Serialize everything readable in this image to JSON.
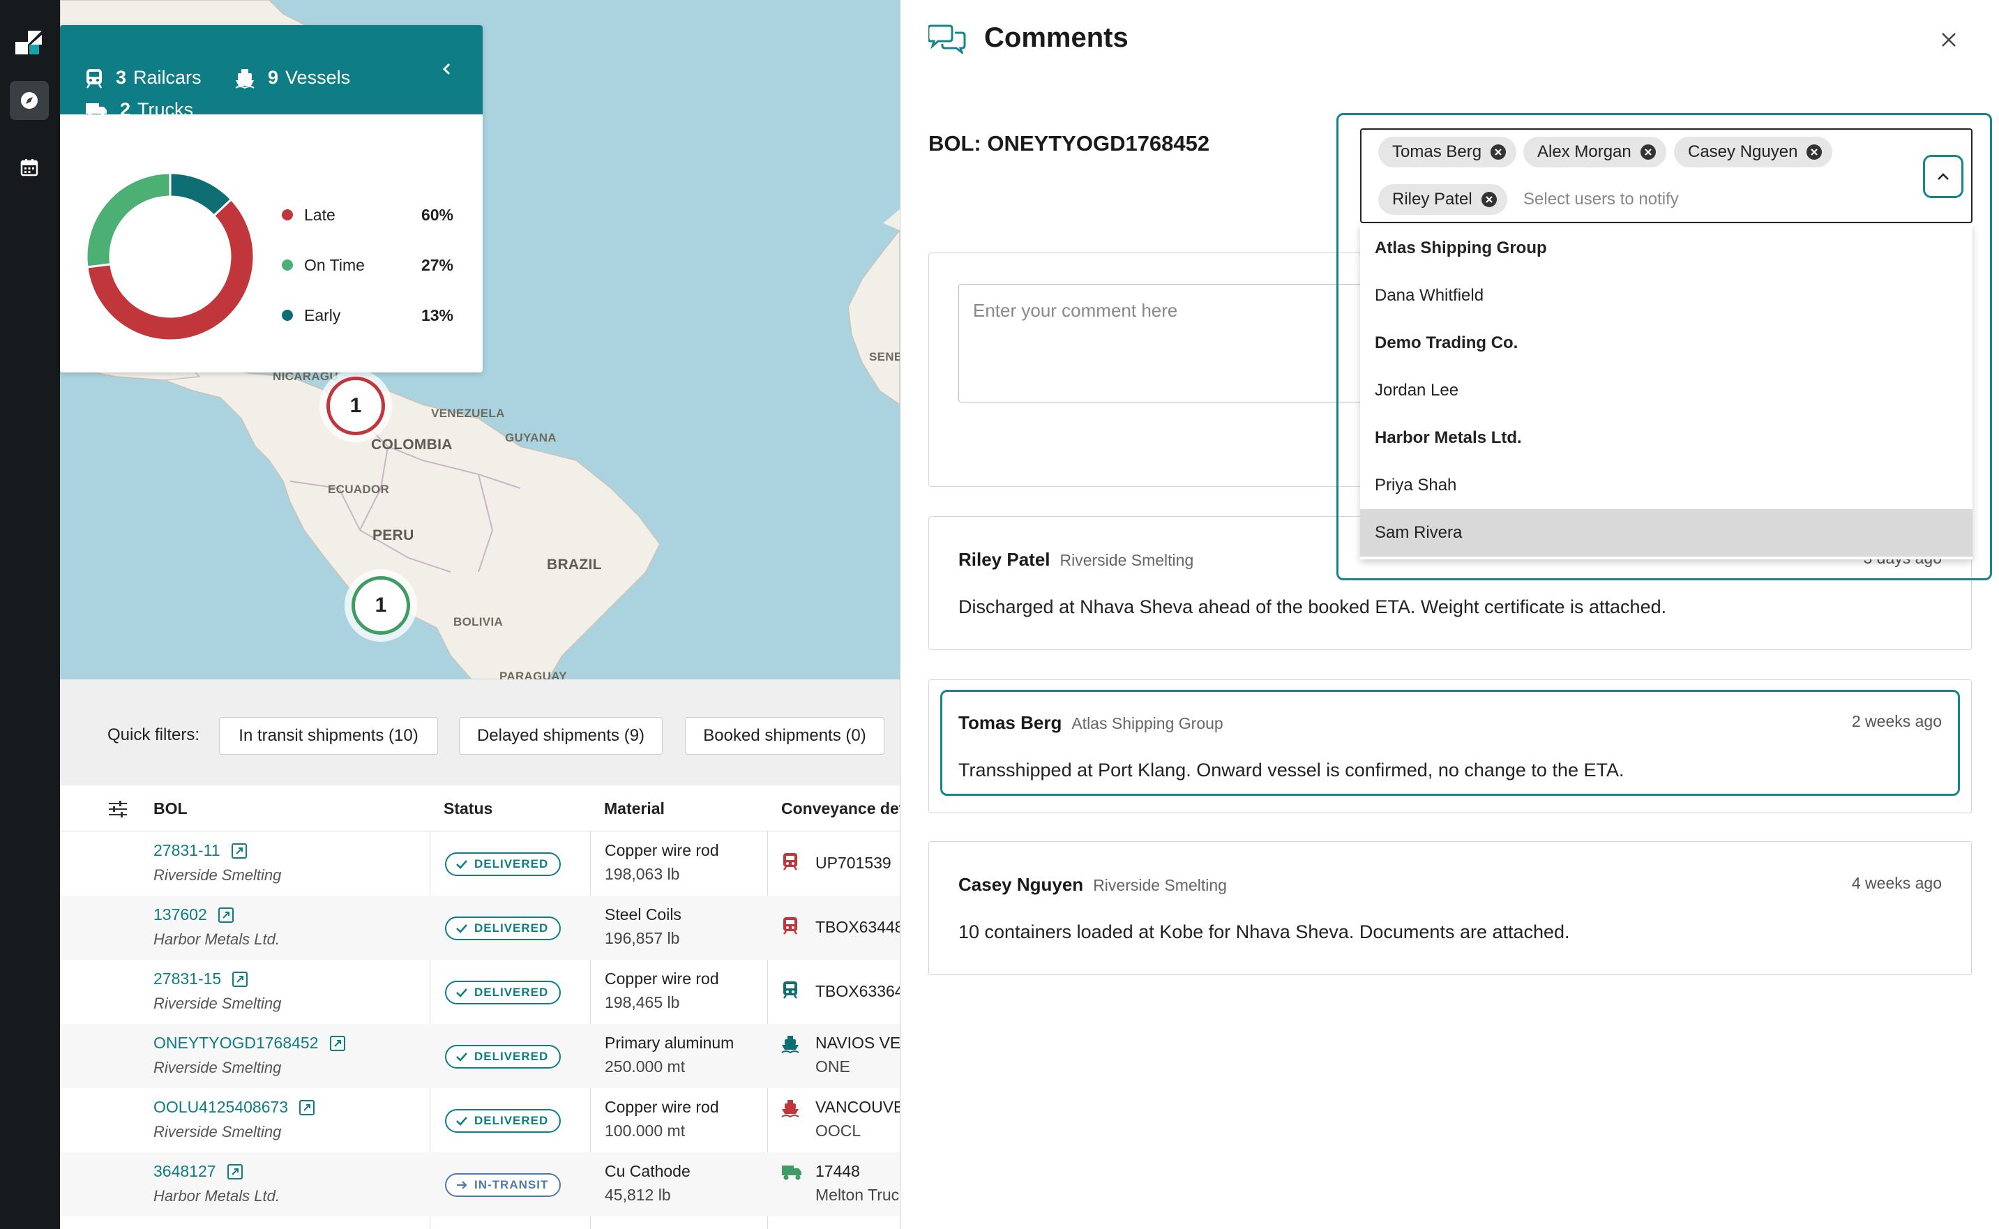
{
  "summary": {
    "railcars_count": "3",
    "railcars_label": "Railcars",
    "vessels_count": "9",
    "vessels_label": "Vessels",
    "trucks_count": "2",
    "trucks_label": "Trucks",
    "legend": [
      {
        "label": "Late",
        "pct": "60%",
        "value": 60,
        "color": "#c0363a"
      },
      {
        "label": "On Time",
        "pct": "27%",
        "value": 27,
        "color": "#4caf73"
      },
      {
        "label": "Early",
        "pct": "13%",
        "value": 13,
        "color": "#0e6e73"
      }
    ]
  },
  "map": {
    "labels": {
      "nicaragua": "NICARAGU",
      "venezuela": "VENEZUELA",
      "guyana": "GUYANA",
      "colombia": "COLOMBIA",
      "ecuador": "ECUADOR",
      "peru": "PERU",
      "brazil": "BRAZIL",
      "bolivia": "BOLIVIA",
      "paraguay": "PARAGUAY",
      "senegal": "SENE"
    },
    "clusters": [
      {
        "count": "1",
        "color": "#c0363a"
      },
      {
        "count": "1",
        "color": "#3f9c63"
      }
    ]
  },
  "quick_filters": {
    "label": "Quick filters:",
    "chips": [
      "In transit shipments (10)",
      "Delayed shipments (9)",
      "Booked shipments (0)"
    ]
  },
  "table": {
    "columns": [
      "BOL",
      "Status",
      "Material",
      "Conveyance det"
    ],
    "rows": [
      {
        "bol": "27831-11",
        "shipper": "Riverside Smelting",
        "status": "DELIVERED",
        "material": "Copper wire rod",
        "qty": "198,063 lb",
        "conv1": "UP701539",
        "conv2": "",
        "icon": "railcar-icon",
        "icon_color": "#c0363a"
      },
      {
        "bol": "137602",
        "shipper": "Harbor Metals Ltd.",
        "status": "DELIVERED",
        "material": "Steel Coils",
        "qty": "196,857 lb",
        "conv1": "TBOX63448",
        "conv2": "",
        "icon": "railcar-icon",
        "icon_color": "#c0363a"
      },
      {
        "bol": "27831-15",
        "shipper": "Riverside Smelting",
        "status": "DELIVERED",
        "material": "Copper wire rod",
        "qty": "198,465 lb",
        "conv1": "TBOX63364",
        "conv2": "",
        "icon": "railcar-icon",
        "icon_color": "#0e6e73"
      },
      {
        "bol": "ONEYTYOGD1768452",
        "shipper": "Riverside Smelting",
        "status": "DELIVERED",
        "material": "Primary aluminum",
        "qty": "250.000 mt",
        "conv1": "NAVIOS VE",
        "conv2": "ONE",
        "icon": "vessel-icon",
        "icon_color": "#0e6e73"
      },
      {
        "bol": "OOLU4125408673",
        "shipper": "Riverside Smelting",
        "status": "DELIVERED",
        "material": "Copper wire rod",
        "qty": "100.000 mt",
        "conv1": "VANCOUVE",
        "conv2": "OOCL",
        "icon": "vessel-icon",
        "icon_color": "#c0363a"
      },
      {
        "bol": "3648127",
        "shipper": "Harbor Metals Ltd.",
        "status": "IN-TRANSIT",
        "material": "Cu Cathode",
        "qty": "45,812 lb",
        "conv1": "17448",
        "conv2": "Melton Truc",
        "icon": "truck-icon",
        "icon_color": "#3f9c63"
      }
    ]
  },
  "panel": {
    "title": "Comments",
    "bol_header": "BOL: ONEYTYOGD1768452",
    "comment_placeholder": "Enter your comment here",
    "notify": {
      "selected": [
        "Tomas Berg",
        "Alex Morgan",
        "Casey Nguyen",
        "Riley Patel"
      ],
      "placeholder": "Select users to notify",
      "options": [
        {
          "label": "Atlas Shipping Group",
          "group": true
        },
        {
          "label": "Dana Whitfield",
          "group": false
        },
        {
          "label": "Demo Trading Co.",
          "group": true
        },
        {
          "label": "Jordan Lee",
          "group": false
        },
        {
          "label": "Harbor Metals Ltd.",
          "group": true
        },
        {
          "label": "Priya Shah",
          "group": false
        },
        {
          "label": "Sam Rivera",
          "group": false,
          "hover": true
        }
      ]
    },
    "comments": [
      {
        "author": "Riley Patel",
        "org": "Riverside Smelting",
        "time": "3 days ago",
        "text": "Discharged at Nhava Sheva ahead of the booked ETA. Weight certificate is attached."
      },
      {
        "author": "Tomas Berg",
        "org": "Atlas Shipping Group",
        "time": "2 weeks ago",
        "text": "Transshipped at Port Klang. Onward vessel is confirmed, no change to the ETA."
      },
      {
        "author": "Casey Nguyen",
        "org": "Riverside Smelting",
        "time": "4 weeks ago",
        "text": "10 containers loaded at Kobe for Nhava Sheva. Documents are attached."
      }
    ]
  }
}
